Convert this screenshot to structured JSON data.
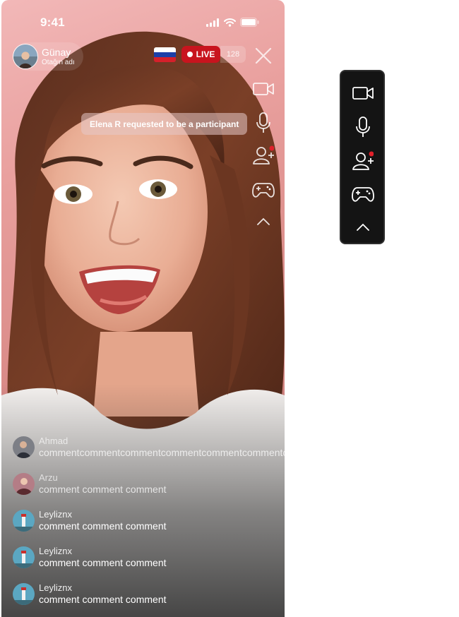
{
  "status_bar": {
    "time": "9:41"
  },
  "host": {
    "name": "Günay",
    "room": "Otağın adı"
  },
  "live": {
    "label": "LIVE",
    "viewers": "128",
    "flag": "russia-flag"
  },
  "toast": {
    "message": "Elena R requested to be a participant"
  },
  "controls": [
    "camera-icon",
    "microphone-icon",
    "add-participant-icon",
    "gamepad-icon",
    "chevron-up-icon"
  ],
  "comments": [
    {
      "user": "Ahmad",
      "text": "commentcommentcommentcommentcommentcommentco"
    },
    {
      "user": "Arzu",
      "text": "comment comment comment"
    },
    {
      "user": "Leyliznx",
      "text": "comment comment comment"
    },
    {
      "user": "Leyliznx",
      "text": "comment comment comment"
    },
    {
      "user": "Leyliznx",
      "text": "comment comment comment"
    }
  ],
  "colors": {
    "live_red": "#c8141e",
    "notification": "#e0202a",
    "toolbar_bg": "#141414"
  }
}
